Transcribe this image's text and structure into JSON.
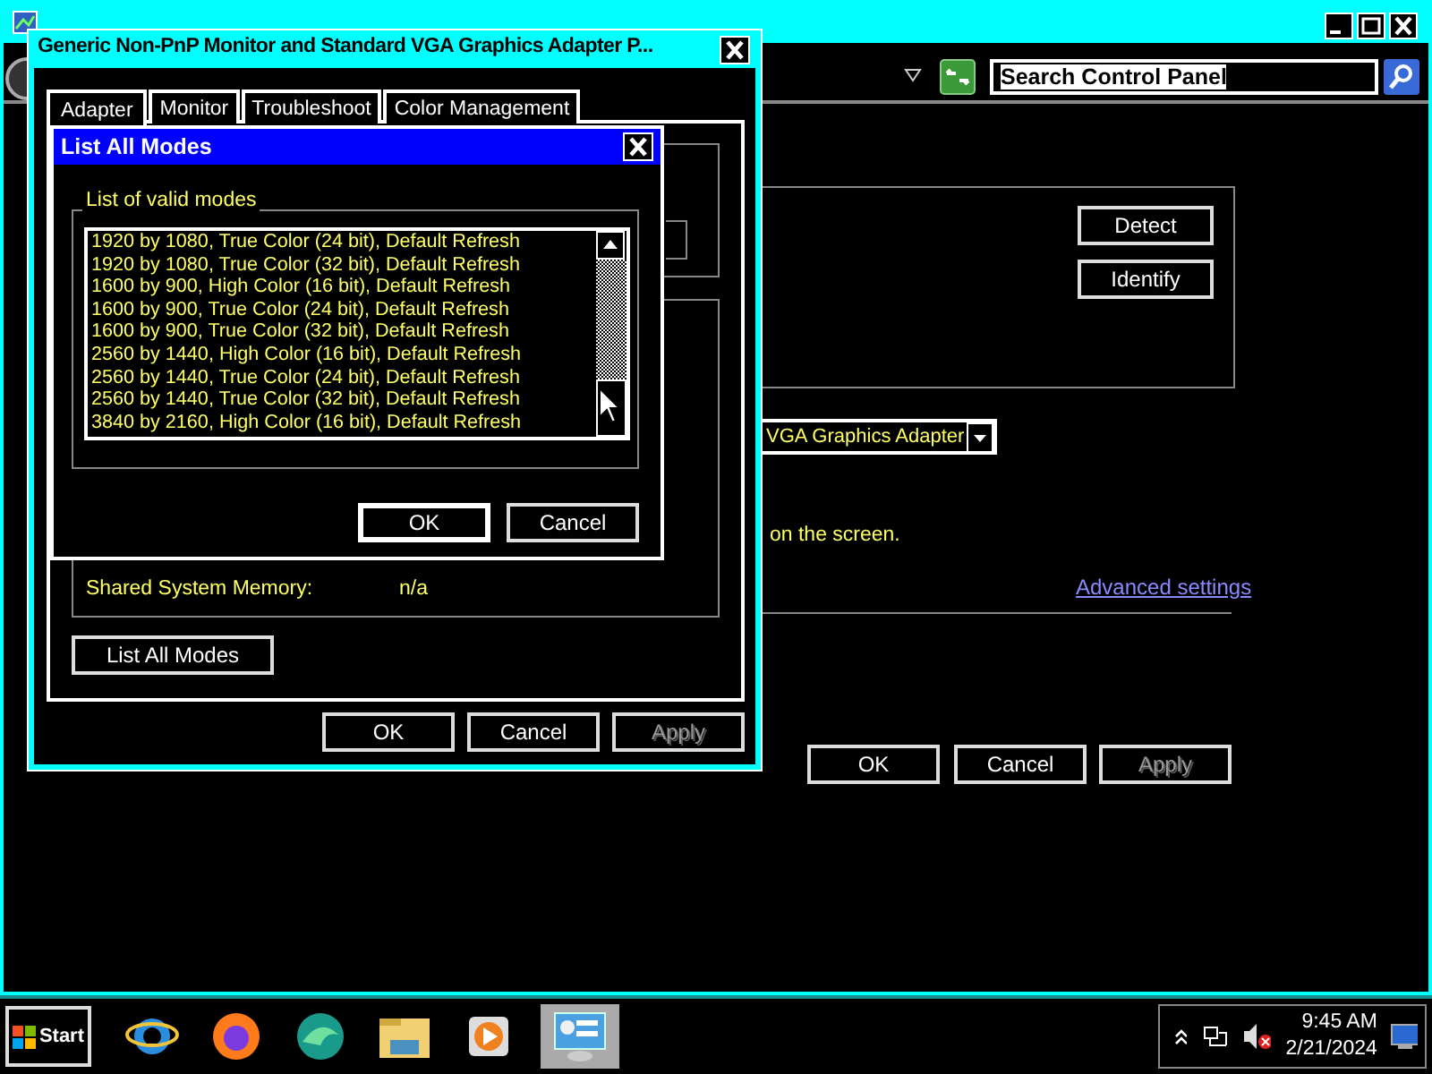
{
  "main_window": {
    "search": {
      "value": "Search Control Panel"
    },
    "side_buttons": [
      "Detect",
      "Identify"
    ],
    "adapter_dropdown": {
      "value": "VGA Graphics Adapter"
    },
    "hint_text": "on the screen.",
    "advanced_link": "Advanced settings",
    "buttons": [
      {
        "label": "OK",
        "disabled": false
      },
      {
        "label": "Cancel",
        "disabled": false
      },
      {
        "label": "Apply",
        "disabled": true
      }
    ]
  },
  "properties_dialog": {
    "title": "Generic Non-PnP Monitor and Standard VGA Graphics Adapter P...",
    "tabs": [
      {
        "label": "Adapter",
        "selected": true
      },
      {
        "label": "Monitor",
        "selected": false
      },
      {
        "label": "Troubleshoot",
        "selected": false
      },
      {
        "label": "Color Management",
        "selected": false
      }
    ],
    "shared_memory": {
      "label": "Shared System Memory:",
      "value": "n/a"
    },
    "list_button": "List All Modes",
    "buttons": [
      {
        "label": "OK",
        "disabled": false
      },
      {
        "label": "Cancel",
        "disabled": false
      },
      {
        "label": "Apply",
        "disabled": true
      }
    ]
  },
  "modes_dialog": {
    "title": "List All Modes",
    "group_label": "List of valid modes",
    "modes": [
      "1920 by 1080, True Color (24 bit), Default Refresh",
      "1920 by 1080, True Color (32 bit), Default Refresh",
      "1600 by 900, High Color (16 bit), Default Refresh",
      "1600 by 900, True Color (24 bit), Default Refresh",
      "1600 by 900, True Color (32 bit), Default Refresh",
      "2560 by 1440, High Color (16 bit), Default Refresh",
      "2560 by 1440, True Color (24 bit), Default Refresh",
      "2560 by 1440, True Color (32 bit), Default Refresh",
      "3840 by 2160, High Color (16 bit), Default Refresh"
    ],
    "buttons": [
      "OK",
      "Cancel"
    ]
  },
  "taskbar": {
    "start": "Start",
    "apps": [
      {
        "kind": "globe",
        "selected": false
      },
      {
        "kind": "fox",
        "selected": false
      },
      {
        "kind": "wave",
        "selected": false
      },
      {
        "kind": "folder",
        "selected": false
      },
      {
        "kind": "play",
        "selected": false
      },
      {
        "kind": "panel",
        "selected": true
      }
    ],
    "clock": {
      "time": "9:45 AM",
      "date": "2/21/2024"
    }
  }
}
